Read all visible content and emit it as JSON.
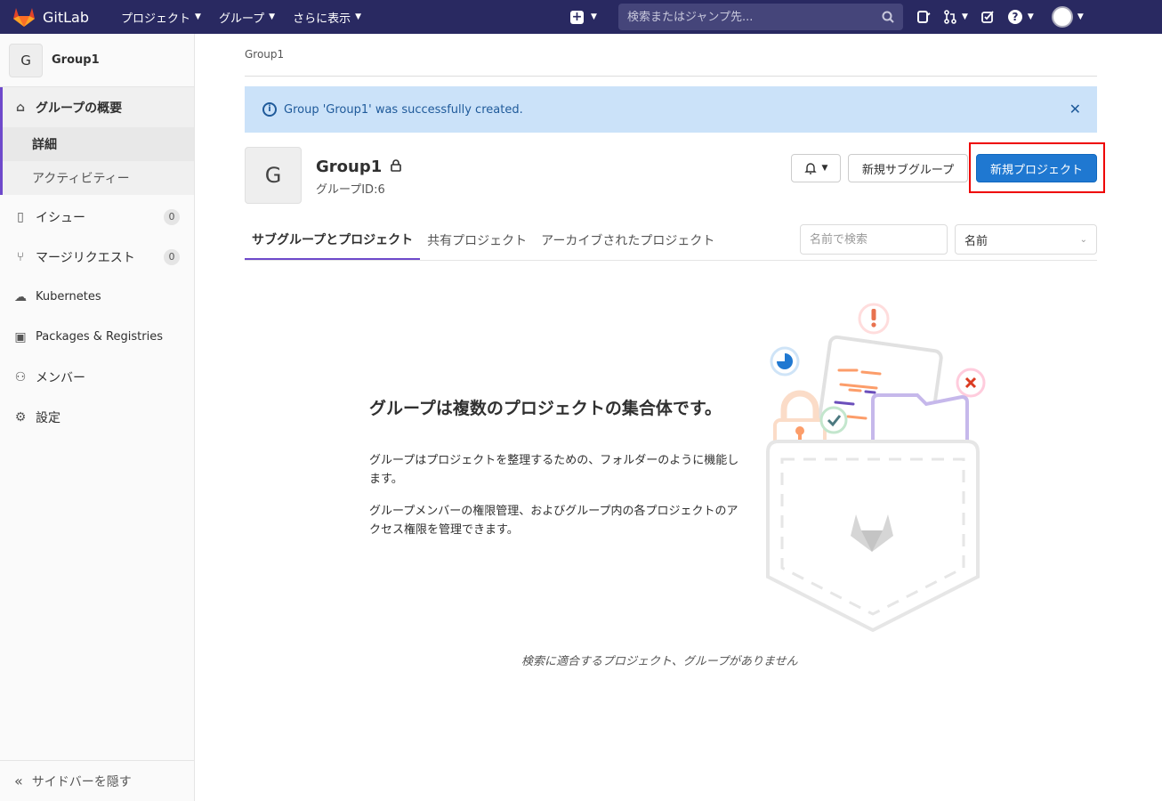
{
  "topbar": {
    "brand": "GitLab",
    "nav": [
      {
        "label": "プロジェクト"
      },
      {
        "label": "グループ"
      },
      {
        "label": "さらに表示"
      }
    ],
    "search_placeholder": "検索またはジャンプ先..."
  },
  "sidebar": {
    "group_initial": "G",
    "group_name": "Group1",
    "overview_label": "グループの概要",
    "sub_items": [
      {
        "label": "詳細"
      },
      {
        "label": "アクティビティー"
      }
    ],
    "items": [
      {
        "label": "イシュー",
        "count": "0",
        "icon": "issues-icon"
      },
      {
        "label": "マージリクエスト",
        "count": "0",
        "icon": "merge-request-icon"
      },
      {
        "label": "Kubernetes",
        "icon": "kubernetes-icon"
      },
      {
        "label": "Packages & Registries",
        "icon": "package-icon"
      },
      {
        "label": "メンバー",
        "icon": "members-icon"
      },
      {
        "label": "設定",
        "icon": "settings-icon"
      }
    ],
    "collapse_label": "サイドバーを隠す"
  },
  "breadcrumb": "Group1",
  "alert": {
    "message": "Group 'Group1' was successfully created."
  },
  "group": {
    "initial": "G",
    "name": "Group1",
    "id_text": "グループID:6"
  },
  "actions": {
    "new_subgroup": "新規サブグループ",
    "new_project": "新規プロジェクト"
  },
  "tabs": [
    {
      "label": "サブグループとプロジェクト",
      "active": true
    },
    {
      "label": "共有プロジェクト"
    },
    {
      "label": "アーカイブされたプロジェクト"
    }
  ],
  "filter": {
    "placeholder": "名前で検索",
    "sort_value": "名前"
  },
  "empty_state": {
    "title": "グループは複数のプロジェクトの集合体です。",
    "p1": "グループはプロジェクトを整理するための、フォルダーのように機能します。",
    "p2": "グループメンバーの権限管理、およびグループ内の各プロジェクトのアクセス権限を管理できます。",
    "note": "検索に適合するプロジェクト、グループがありません"
  },
  "colors": {
    "navbar": "#292961",
    "primary": "#1f78d1",
    "alert_bg": "#cbe2f9",
    "active_tab": "#6e49cb",
    "highlight": "#e00000"
  }
}
